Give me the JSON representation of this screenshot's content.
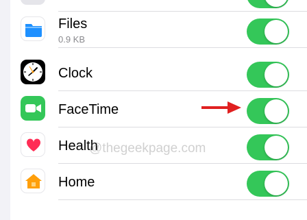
{
  "settings": {
    "rows": [
      {
        "label": "",
        "toggle_on": true,
        "icon": "app-icon-partial"
      },
      {
        "label": "Files",
        "sublabel": "0.9 KB",
        "toggle_on": true,
        "icon": "files-folder-icon"
      },
      {
        "label": "Clock",
        "toggle_on": true,
        "icon": "clock-icon"
      },
      {
        "label": "FaceTime",
        "toggle_on": true,
        "icon": "facetime-camera-icon"
      },
      {
        "label": "Health",
        "toggle_on": true,
        "icon": "health-heart-icon"
      },
      {
        "label": "Home",
        "toggle_on": true,
        "icon": "home-house-icon"
      }
    ]
  },
  "watermark": "@thegeekpage.com",
  "colors": {
    "toggle_on": "#34c759",
    "files_blue": "#1e90ff",
    "facetime_green": "#34c759",
    "home_orange": "#ff9f0a",
    "health_red": "#ff2d55",
    "annotation_arrow": "#e02020"
  }
}
